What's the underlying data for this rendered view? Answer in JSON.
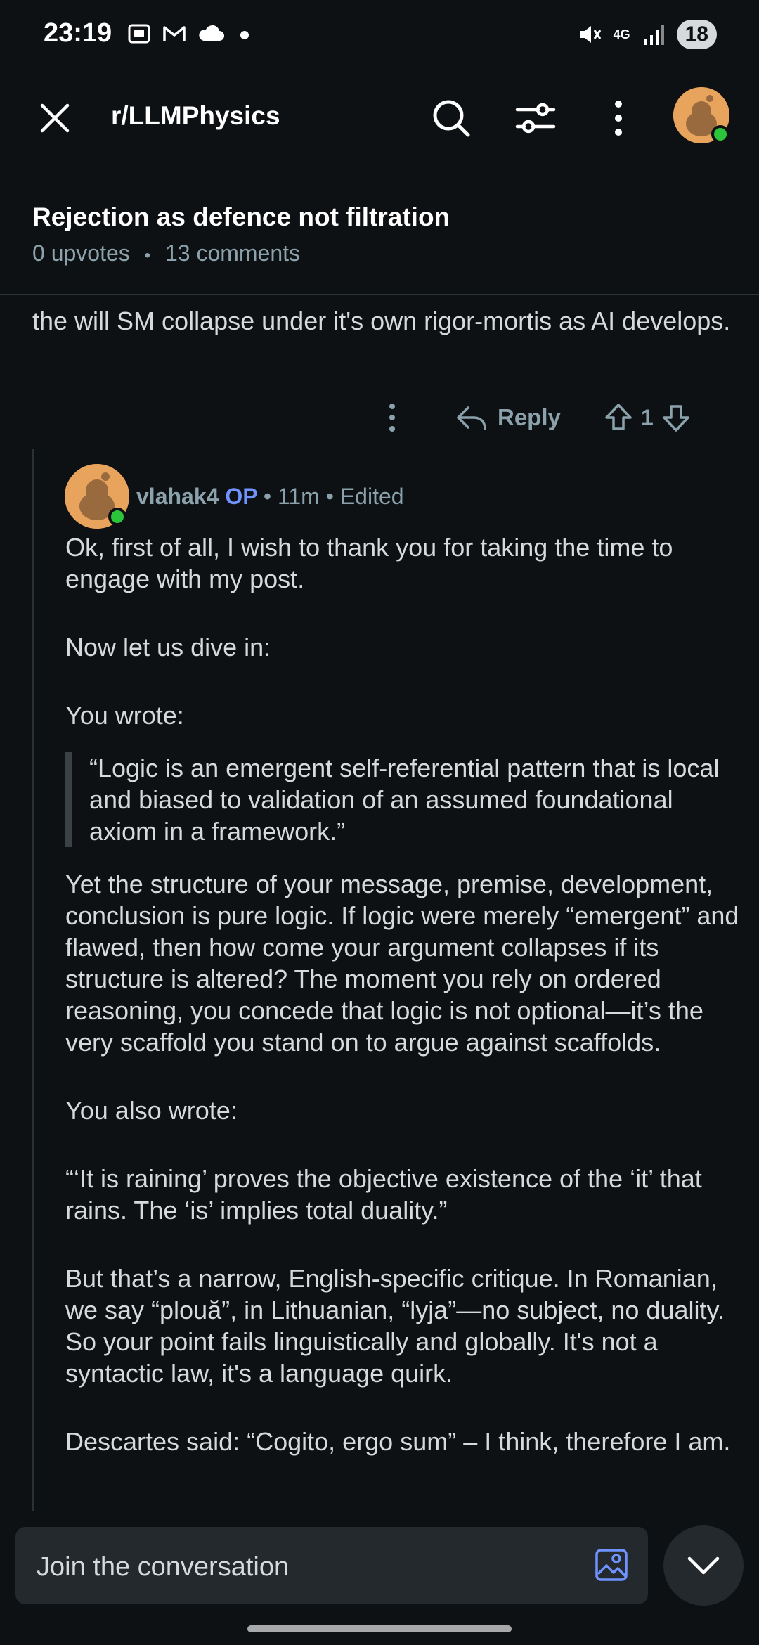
{
  "status_bar": {
    "time": "23:19",
    "network": "4G",
    "battery": "18",
    "icons_left": [
      "screenshot-icon",
      "gmail-icon",
      "cloud-icon",
      "dot-icon"
    ],
    "icons_right": [
      "mute-icon",
      "network-4g-icon",
      "signal-icon",
      "battery-icon"
    ]
  },
  "appbar": {
    "subreddit": "r/LLMPhysics"
  },
  "post": {
    "title": "Rejection as defence not filtration",
    "upvotes": "0 upvotes",
    "separator": "•",
    "comments": "13 comments"
  },
  "prev_comment": {
    "text": "the will SM collapse under it's own rigor-mortis as AI develops.",
    "reply_label": "Reply",
    "score": "1"
  },
  "comment": {
    "author": "vlahak4",
    "op_badge": "OP",
    "meta": "• 11m • Edited",
    "p1": "Ok, first of all, I wish to thank you for taking the time to engage with my post.",
    "p2": "Now let us dive in:",
    "p3": "You wrote:",
    "quote": "“Logic is an emergent self-referential pattern that is local and biased to validation of an assumed foundational axiom in a framework.”",
    "p4": "Yet the structure of your message, premise, development, conclusion is pure logic. If logic were merely “emergent” and flawed, then how come your argument collapses if its structure is altered? The moment you rely on ordered reasoning, you concede that logic is not optional—it’s the very scaffold you stand on to argue against scaffolds.",
    "p5": "You also wrote:",
    "p6": "“‘It is raining’ proves the objective existence of the ‘it’ that rains. The ‘is’ implies total duality.”",
    "p7": "But that’s a narrow, English-specific critique. In Romanian, we say “plouă”, in Lithuanian, “lyja”—no subject, no duality. So your point fails linguistically and globally. It's not a syntactic law, it's a language quirk.",
    "p8": "Descartes said: “Cogito, ergo sum” – I think, therefore I am."
  },
  "composer": {
    "placeholder": "Join the conversation"
  },
  "colors": {
    "background": "#0e1113",
    "op_badge": "#7193ff",
    "online": "#2cc43b",
    "avatar": "#e8a45c"
  }
}
